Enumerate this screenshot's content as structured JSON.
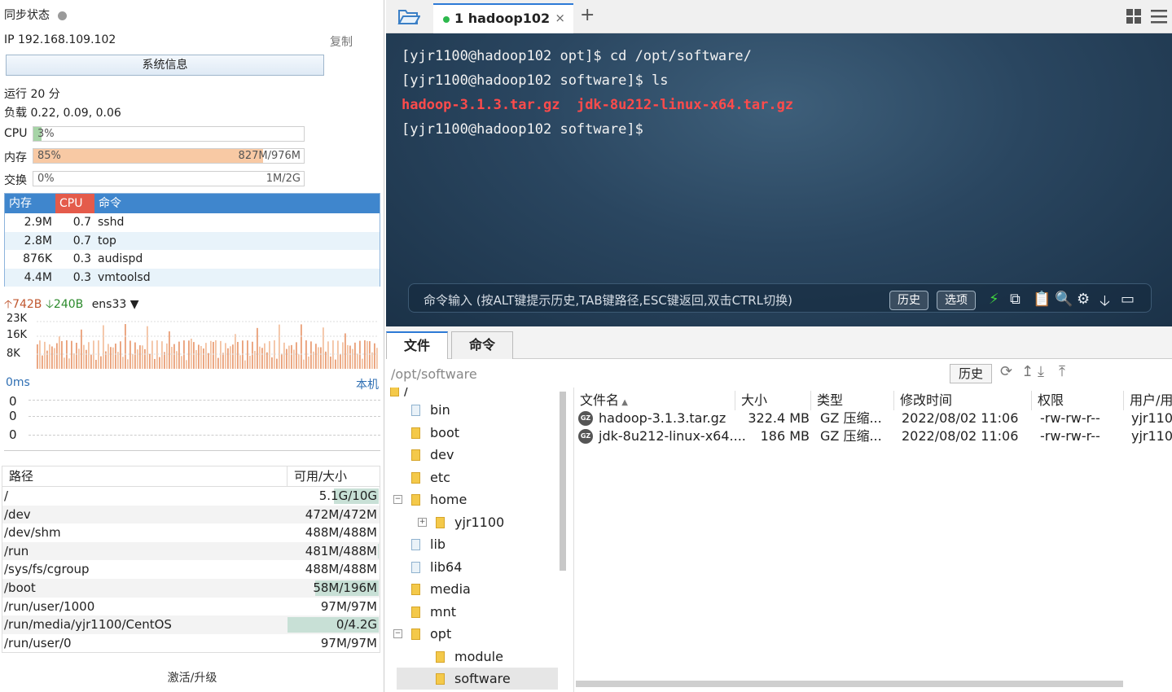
{
  "sysinfo": {
    "sync_label": "同步状态",
    "ip": "IP 192.168.109.102",
    "copy": "复制",
    "sys_button": "系统信息",
    "uptime": "运行 20 分",
    "load": "负载 0.22, 0.09, 0.06"
  },
  "bars": [
    {
      "label": "CPU",
      "left": "3%",
      "right": "",
      "fraction": 0.03,
      "color": "#a6d4a6"
    },
    {
      "label": "内存",
      "left": "85%",
      "right": "827M/976M",
      "fraction": 0.85,
      "color": "#f8c9a4"
    },
    {
      "label": "交换",
      "left": "0%",
      "right": "1M/2G",
      "fraction": 0.0,
      "color": "#a6d4a6"
    }
  ],
  "proc": {
    "headers": [
      "内存",
      "CPU",
      "命令"
    ],
    "rows": [
      [
        "2.9M",
        "0.7",
        "sshd"
      ],
      [
        "2.8M",
        "0.7",
        "top"
      ],
      [
        "876K",
        "0.3",
        "audispd"
      ],
      [
        "4.4M",
        "0.3",
        "vmtoolsd"
      ]
    ]
  },
  "net": {
    "up": "742B",
    "down": "240B",
    "iface": "ens33",
    "ticks": [
      "23K",
      "16K",
      "8K"
    ]
  },
  "ping": {
    "label": "0ms",
    "host": "本机",
    "values": [
      "0",
      "0",
      "0"
    ]
  },
  "disk": {
    "headers": [
      "路径",
      "可用/大小"
    ],
    "rows": [
      {
        "path": "/",
        "size": "5.1G/10G",
        "used": 0.49
      },
      {
        "path": "/dev",
        "size": "472M/472M",
        "used": 0
      },
      {
        "path": "/dev/shm",
        "size": "488M/488M",
        "used": 0
      },
      {
        "path": "/run",
        "size": "481M/488M",
        "used": 0.01
      },
      {
        "path": "/sys/fs/cgroup",
        "size": "488M/488M",
        "used": 0
      },
      {
        "path": "/boot",
        "size": "58M/196M",
        "used": 0.7
      },
      {
        "path": "/run/user/1000",
        "size": "97M/97M",
        "used": 0
      },
      {
        "path": "/run/media/yjr1100/CentOS",
        "size": "0/4.2G",
        "used": 1.0
      },
      {
        "path": "/run/user/0",
        "size": "97M/97M",
        "used": 0
      }
    ]
  },
  "activate": "激活/升级",
  "tab": {
    "label": "1 hadoop102",
    "close": "×",
    "add": "+"
  },
  "terminal": {
    "line1": "[yjr1100@hadoop102 opt]$ cd /opt/software/",
    "line2": "[yjr1100@hadoop102 software]$ ls",
    "file1": "hadoop-3.1.3.tar.gz",
    "file2": "jdk-8u212-linux-x64.tar.gz",
    "line4": "[yjr1100@hadoop102 software]$"
  },
  "cmdbar": {
    "placeholder": "命令输入 (按ALT键提示历史,TAB键路径,ESC键返回,双击CTRL切换)",
    "history": "历史",
    "options": "选项"
  },
  "fm": {
    "tab_files": "文件",
    "tab_cmds": "命令",
    "path": "/opt/software",
    "history": "历史"
  },
  "tree": {
    "root": "/",
    "items": [
      {
        "name": "bin",
        "depth": 1,
        "pm": ""
      },
      {
        "name": "boot",
        "depth": 1,
        "pm": ""
      },
      {
        "name": "dev",
        "depth": 1,
        "pm": ""
      },
      {
        "name": "etc",
        "depth": 1,
        "pm": ""
      },
      {
        "name": "home",
        "depth": 1,
        "pm": "−"
      },
      {
        "name": "yjr1100",
        "depth": 2,
        "pm": "+"
      },
      {
        "name": "lib",
        "depth": 1,
        "pm": ""
      },
      {
        "name": "lib64",
        "depth": 1,
        "pm": ""
      },
      {
        "name": "media",
        "depth": 1,
        "pm": ""
      },
      {
        "name": "mnt",
        "depth": 1,
        "pm": ""
      },
      {
        "name": "opt",
        "depth": 1,
        "pm": "−"
      },
      {
        "name": "module",
        "depth": 2,
        "pm": ""
      },
      {
        "name": "software",
        "depth": 2,
        "pm": ""
      }
    ]
  },
  "files": {
    "headers": [
      "文件名",
      "大小",
      "类型",
      "修改时间",
      "权限",
      "用户/用"
    ],
    "rows": [
      [
        "hadoop-3.1.3.tar.gz",
        "322.4 MB",
        "GZ 压缩...",
        "2022/08/02 11:06",
        "-rw-rw-r--",
        "yjr1100"
      ],
      [
        "jdk-8u212-linux-x64....",
        "186 MB",
        "GZ 压缩...",
        "2022/08/02 11:06",
        "-rw-rw-r--",
        "yjr1100"
      ]
    ]
  }
}
